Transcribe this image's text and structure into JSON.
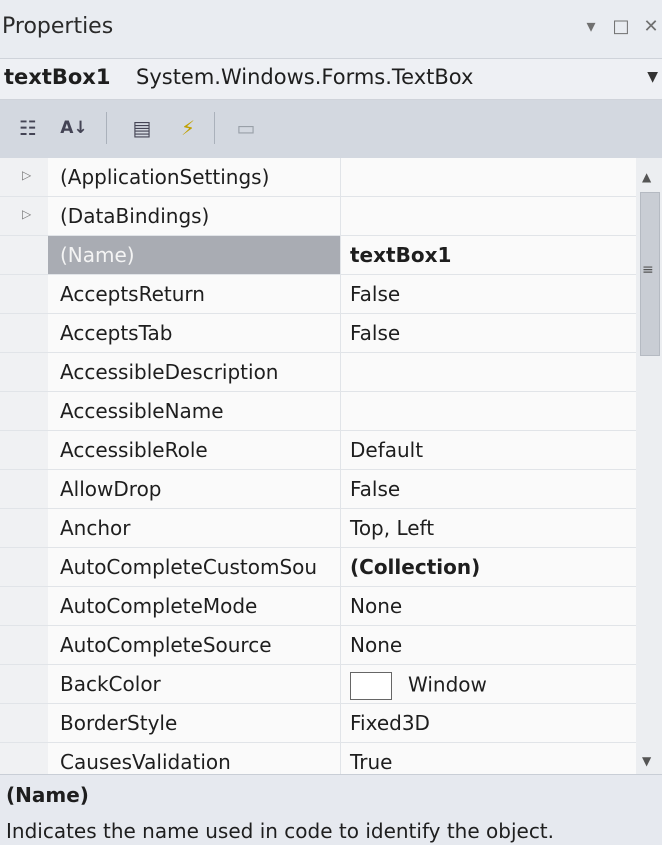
{
  "window": {
    "title": "Properties"
  },
  "object_selector": {
    "name": "textBox1",
    "type": "System.Windows.Forms.TextBox"
  },
  "toolbar": {
    "categorized_icon": "categorized-icon",
    "alphabetical_icon": "alphabetical-sort-icon",
    "properties_icon": "properties-icon",
    "events_icon": "events-lightning-icon",
    "property_pages_icon": "property-pages-icon"
  },
  "properties": [
    {
      "name": "(ApplicationSettings)",
      "value": "",
      "expandable": true
    },
    {
      "name": "(DataBindings)",
      "value": "",
      "expandable": true
    },
    {
      "name": "(Name)",
      "value": "textBox1",
      "bold_value": true,
      "selected": true
    },
    {
      "name": "AcceptsReturn",
      "value": "False"
    },
    {
      "name": "AcceptsTab",
      "value": "False"
    },
    {
      "name": "AccessibleDescription",
      "value": ""
    },
    {
      "name": "AccessibleName",
      "value": ""
    },
    {
      "name": "AccessibleRole",
      "value": "Default"
    },
    {
      "name": "AllowDrop",
      "value": "False"
    },
    {
      "name": "Anchor",
      "value": "Top, Left"
    },
    {
      "name": "AutoCompleteCustomSou",
      "value": "(Collection)",
      "bold_value": true
    },
    {
      "name": "AutoCompleteMode",
      "value": "None"
    },
    {
      "name": "AutoCompleteSource",
      "value": "None"
    },
    {
      "name": "BackColor",
      "value": "Window",
      "swatch": "#ffffff"
    },
    {
      "name": "BorderStyle",
      "value": "Fixed3D"
    },
    {
      "name": "CausesValidation",
      "value": "True"
    }
  ],
  "description": {
    "title": "(Name)",
    "text": "Indicates the name used in code to identify the object."
  }
}
